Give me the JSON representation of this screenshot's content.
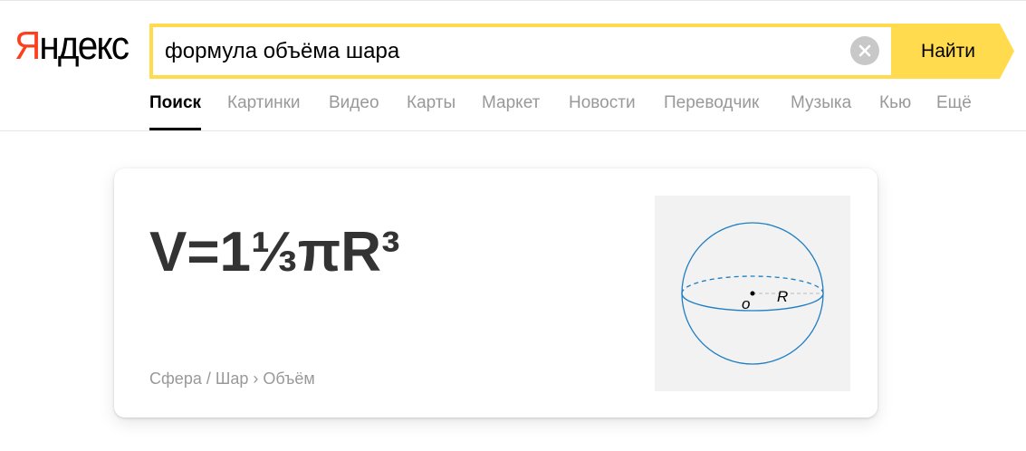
{
  "logo": {
    "first_letter": "Я",
    "rest": "ндекс"
  },
  "search": {
    "query": "формула объёма шара",
    "button_label": "Найти"
  },
  "nav": {
    "tabs": [
      {
        "label": "Поиск",
        "active": true
      },
      {
        "label": "Картинки"
      },
      {
        "label": "Видео"
      },
      {
        "label": "Карты"
      },
      {
        "label": "Маркет"
      },
      {
        "label": "Новости"
      },
      {
        "label": "Переводчик"
      },
      {
        "label": "Музыка"
      },
      {
        "label": "Кью"
      },
      {
        "label": "Ещё"
      }
    ]
  },
  "card": {
    "formula": "V=1⅓πR³",
    "breadcrumb": {
      "item1": "Сфера / Шар",
      "separator": "›",
      "item2": "Объём"
    },
    "diagram": {
      "center_label": "o",
      "radius_label": "R"
    }
  },
  "colors": {
    "accent_yellow": "#ffdb4d",
    "logo_red": "#fc3f1d",
    "sphere_stroke": "#1f7ec2"
  }
}
